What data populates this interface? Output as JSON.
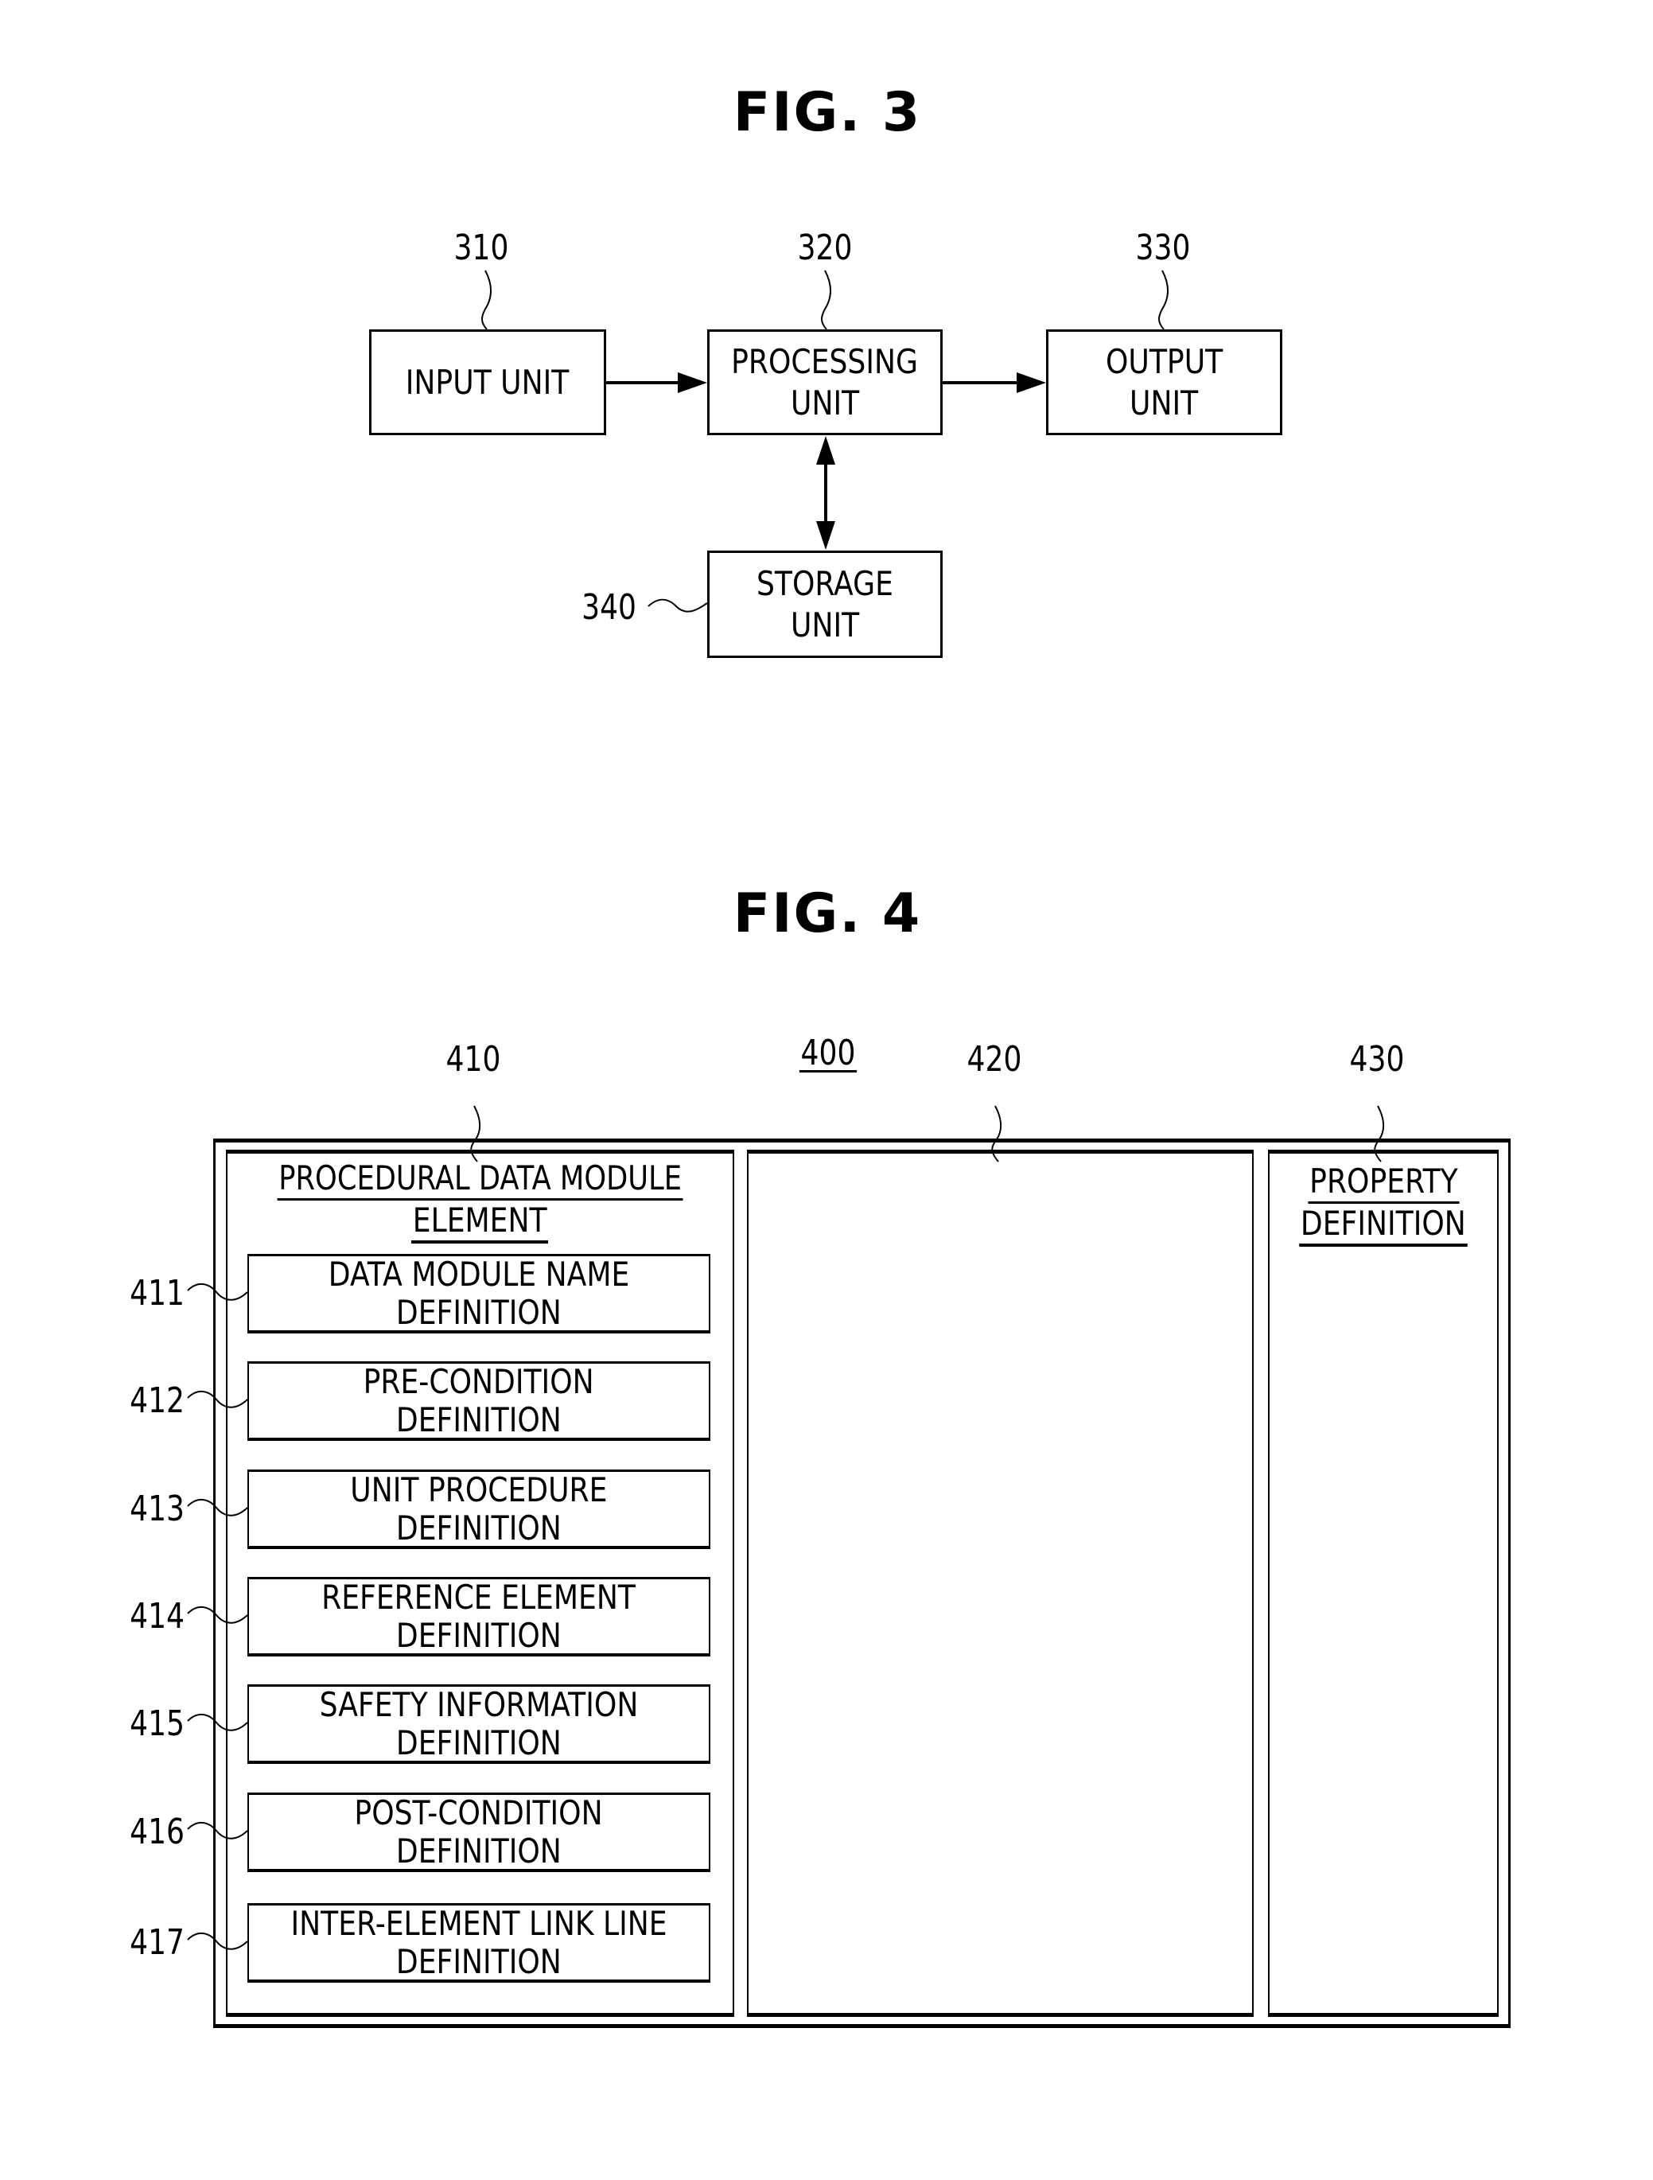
{
  "fig3": {
    "title": "FIG. 3",
    "blocks": [
      {
        "ref": "310",
        "lines": [
          "INPUT UNIT"
        ]
      },
      {
        "ref": "320",
        "lines": [
          "PROCESSING",
          "UNIT"
        ]
      },
      {
        "ref": "330",
        "lines": [
          "OUTPUT",
          "UNIT"
        ]
      },
      {
        "ref": "340",
        "lines": [
          "STORAGE",
          "UNIT"
        ]
      }
    ],
    "connections": [
      {
        "from": "310",
        "to": "320",
        "type": "one-way"
      },
      {
        "from": "320",
        "to": "330",
        "type": "one-way"
      },
      {
        "from": "320",
        "to": "340",
        "type": "two-way"
      }
    ]
  },
  "fig4": {
    "title": "FIG. 4",
    "screen_ref": "400",
    "panels": [
      {
        "ref": "410",
        "heading_lines": [
          "PROCEDURAL DATA MODULE",
          "ELEMENT"
        ]
      },
      {
        "ref": "420",
        "heading_lines": []
      },
      {
        "ref": "430",
        "heading_lines": [
          "PROPERTY",
          "DEFINITION"
        ]
      }
    ],
    "items": [
      {
        "ref": "411",
        "lines": [
          "DATA MODULE NAME",
          "DEFINITION"
        ]
      },
      {
        "ref": "412",
        "lines": [
          "PRE-CONDITION",
          "DEFINITION"
        ]
      },
      {
        "ref": "413",
        "lines": [
          "UNIT PROCEDURE",
          "DEFINITION"
        ]
      },
      {
        "ref": "414",
        "lines": [
          "REFERENCE ELEMENT",
          "DEFINITION"
        ]
      },
      {
        "ref": "415",
        "lines": [
          "SAFETY INFORMATION",
          "DEFINITION"
        ]
      },
      {
        "ref": "416",
        "lines": [
          "POST-CONDITION",
          "DEFINITION"
        ]
      },
      {
        "ref": "417",
        "lines": [
          "INTER-ELEMENT LINK LINE",
          "DEFINITION"
        ]
      }
    ]
  }
}
